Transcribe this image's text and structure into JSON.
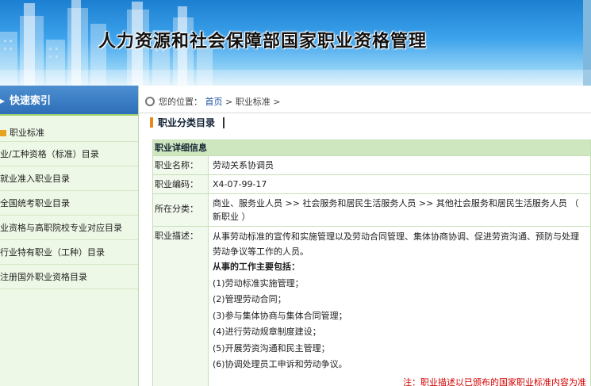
{
  "banner": {
    "title": "人力资源和社会保障部国家职业资格管理"
  },
  "sidebar": {
    "header": "快速索引",
    "items": [
      {
        "label": "职业标准"
      },
      {
        "label": "业/工种资格（标准）目录"
      },
      {
        "label": "就业准入职业目录"
      },
      {
        "label": "全国统考职业目录"
      },
      {
        "label": "业资格与高职院校专业对应目录"
      },
      {
        "label": "行业特有职业（工种）目录"
      },
      {
        "label": "注册国外职业资格目录"
      }
    ]
  },
  "breadcrumb": {
    "prefix": "您的位置：",
    "home": "首页",
    "sep1": ">",
    "current": "职业标准",
    "sep2": ">"
  },
  "section": {
    "title": "职业分类目录"
  },
  "detail": {
    "header": "职业详细信息",
    "name_label": "职业名称：",
    "name_value": "劳动关系协调员",
    "code_label": "职业编码：",
    "code_value": "X4-07-99-17",
    "category_label": "所在分类：",
    "category_value": "商业、服务业人员 >> 社会服务和居民生活服务人员 >> 其他社会服务和居民生活服务人员 （ 新职业 ）",
    "desc_label": "职业描述：",
    "desc_intro": "从事劳动标准的宣传和实施管理以及劳动合同管理、集体协商协调、促进劳资沟通、预防与处理劳动争议等工作的人员。",
    "desc_subtitle": "从事的工作主要包括：",
    "desc_items": [
      "(1)劳动标准实施管理；",
      "(2)管理劳动合同；",
      "(3)参与集体协商与集体合同管理；",
      "(4)进行劳动规章制度建设；",
      "(5)开展劳资沟通和民主管理；",
      "(6)协调处理员工申诉和劳动争议。"
    ],
    "desc_note": "注：职业描述以已颁布的国家职业标准内容为准"
  }
}
